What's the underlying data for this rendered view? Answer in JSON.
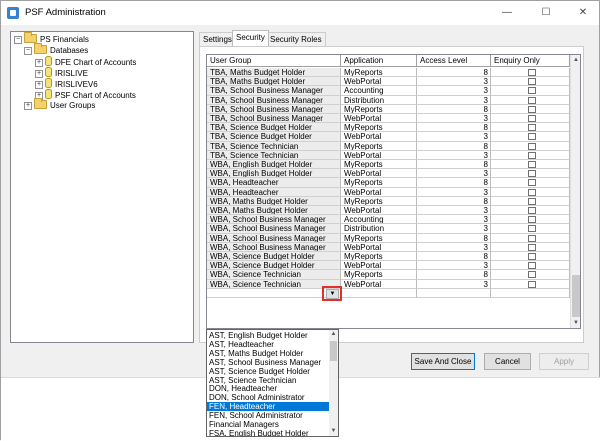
{
  "window": {
    "title": "PSF Administration",
    "minimize": "—",
    "maximize": "☐",
    "close": "✕"
  },
  "tree": {
    "root": "PS Financials",
    "databases": "Databases",
    "dbs": [
      "DFE Chart of Accounts",
      "IRISLIVE",
      "IRISLIVEV6",
      "PSF Chart of Accounts"
    ],
    "user_groups": "User Groups"
  },
  "tabs": [
    "Settings",
    "Security",
    "Security Roles"
  ],
  "grid": {
    "headers": [
      "User Group",
      "Application",
      "Access Level",
      "Enquiry Only"
    ],
    "rows": [
      [
        "TBA, Maths Budget Holder",
        "MyReports",
        "8"
      ],
      [
        "TBA, Maths Budget Holder",
        "WebPortal",
        "3"
      ],
      [
        "TBA, School Business Manager",
        "Accounting",
        "3"
      ],
      [
        "TBA, School Business Manager",
        "Distribution",
        "3"
      ],
      [
        "TBA, School Business Manager",
        "MyReports",
        "8"
      ],
      [
        "TBA, School Business Manager",
        "WebPortal",
        "3"
      ],
      [
        "TBA, Science Budget Holder",
        "MyReports",
        "8"
      ],
      [
        "TBA, Science Budget Holder",
        "WebPortal",
        "3"
      ],
      [
        "TBA, Science Technician",
        "MyReports",
        "8"
      ],
      [
        "TBA, Science Technician",
        "WebPortal",
        "3"
      ],
      [
        "WBA, English Budget Holder",
        "MyReports",
        "8"
      ],
      [
        "WBA, English Budget Holder",
        "WebPortal",
        "3"
      ],
      [
        "WBA, Headteacher",
        "MyReports",
        "8"
      ],
      [
        "WBA, Headteacher",
        "WebPortal",
        "3"
      ],
      [
        "WBA, Maths Budget Holder",
        "MyReports",
        "8"
      ],
      [
        "WBA, Maths Budget Holder",
        "WebPortal",
        "3"
      ],
      [
        "WBA, School Business Manager",
        "Accounting",
        "3"
      ],
      [
        "WBA, School Business Manager",
        "Distribution",
        "3"
      ],
      [
        "WBA, School Business Manager",
        "MyReports",
        "8"
      ],
      [
        "WBA, School Business Manager",
        "WebPortal",
        "3"
      ],
      [
        "WBA, Science Budget Holder",
        "MyReports",
        "8"
      ],
      [
        "WBA, Science Budget Holder",
        "WebPortal",
        "3"
      ],
      [
        "WBA, Science Technician",
        "MyReports",
        "8"
      ],
      [
        "WBA, Science Technician",
        "WebPortal",
        "3"
      ]
    ]
  },
  "dropdown": {
    "items": [
      "AST, English Budget Holder",
      "AST, Headteacher",
      "AST, Maths Budget Holder",
      "AST, School Business Manager",
      "AST, Science Budget Holder",
      "AST, Science Technician",
      "DON, Headteacher",
      "DON, School Administrator",
      "FEN, Headteacher",
      "FEN, School Administrator",
      "Financial Managers",
      "FSA, English Budget Holder"
    ],
    "selected_index": 8
  },
  "buttons": {
    "save": "Save And Close",
    "cancel": "Cancel",
    "apply": "Apply"
  },
  "colors": {
    "selection": "#0078d7",
    "highlight_border": "#e03030"
  }
}
